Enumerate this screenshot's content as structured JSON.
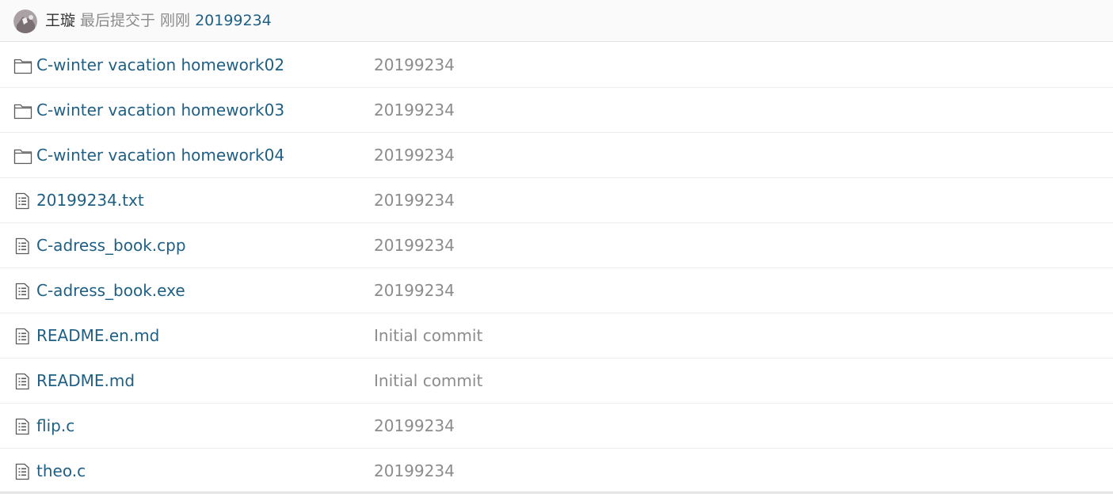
{
  "commit": {
    "author": "王璇",
    "meta_text": "最后提交于 刚刚",
    "commit_id": "20199234"
  },
  "rows": [
    {
      "type": "folder",
      "icon": "folder-icon",
      "name": "C-winter vacation homework02",
      "message": "20199234"
    },
    {
      "type": "folder",
      "icon": "folder-icon",
      "name": "C-winter vacation homework03",
      "message": "20199234"
    },
    {
      "type": "folder",
      "icon": "folder-icon",
      "name": "C-winter vacation homework04",
      "message": "20199234"
    },
    {
      "type": "file",
      "icon": "file-icon",
      "name": "20199234.txt",
      "message": "20199234"
    },
    {
      "type": "file",
      "icon": "file-icon",
      "name": "C-adress_book.cpp",
      "message": "20199234"
    },
    {
      "type": "file",
      "icon": "file-icon",
      "name": "C-adress_book.exe",
      "message": "20199234"
    },
    {
      "type": "file",
      "icon": "file-icon",
      "name": "README.en.md",
      "message": "Initial commit"
    },
    {
      "type": "file",
      "icon": "file-icon",
      "name": "README.md",
      "message": "Initial commit"
    },
    {
      "type": "file",
      "icon": "file-icon",
      "name": "flip.c",
      "message": "20199234"
    },
    {
      "type": "file",
      "icon": "file-icon",
      "name": "theo.c",
      "message": "20199234"
    }
  ],
  "colors": {
    "link": "#1f5f84",
    "muted": "#8c8c8c",
    "icon": "#5a5a5a"
  }
}
